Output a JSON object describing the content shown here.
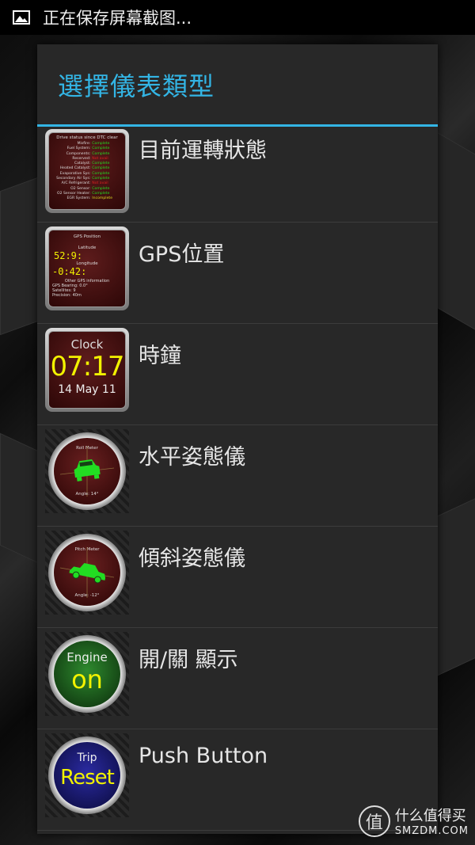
{
  "status_bar": {
    "notification_text": "正在保存屏幕截图..."
  },
  "dialog": {
    "title": "選擇儀表類型",
    "items": [
      {
        "label": "目前運轉狀態",
        "thumb": {
          "header": "Drive status since DTC clear",
          "rows": [
            {
              "name": "Misfire:",
              "value": "Complete",
              "color": "#22dd22"
            },
            {
              "name": "Fuel System:",
              "value": "Complete",
              "color": "#22dd22"
            },
            {
              "name": "Components:",
              "value": "Complete",
              "color": "#22dd22"
            },
            {
              "name": "Reserved:",
              "value": "Not avail",
              "color": "#dd2222"
            },
            {
              "name": "Catalyst:",
              "value": "Complete",
              "color": "#22dd22"
            },
            {
              "name": "Heated Catalyst:",
              "value": "Complete",
              "color": "#22dd22"
            },
            {
              "name": "Evaporative Sys:",
              "value": "Complete",
              "color": "#22dd22"
            },
            {
              "name": "Secondary Air Sys:",
              "value": "Complete",
              "color": "#22dd22"
            },
            {
              "name": "A/C Refrigerant:",
              "value": "Not avail",
              "color": "#dd2222"
            },
            {
              "name": "O2 Sensor:",
              "value": "Complete",
              "color": "#22dd22"
            },
            {
              "name": "O2 Sensor Heater:",
              "value": "Complete",
              "color": "#22dd22"
            },
            {
              "name": "EGR System:",
              "value": "Incomplete",
              "color": "#dddd22"
            }
          ]
        }
      },
      {
        "label": "GPS位置",
        "thumb": {
          "header": "GPS Position",
          "lat_label": "Latitude",
          "lat_value": "52:9:",
          "lon_label": "Longitude",
          "lon_value": "-0:42:",
          "other_label": "Other GPS information",
          "bearing": "GPS Bearing: 0.0°",
          "satellites": "Satellites: 9",
          "precision": "Precision: 40m"
        }
      },
      {
        "label": "時鐘",
        "thumb": {
          "header": "Clock",
          "time": "07:17",
          "date": "14 May 11"
        }
      },
      {
        "label": "水平姿態儀",
        "thumb": {
          "header": "Roll Meter",
          "angle": "Angle: 14°"
        }
      },
      {
        "label": "傾斜姿態儀",
        "thumb": {
          "header": "Pitch Meter",
          "angle": "Angle: -12°"
        }
      },
      {
        "label": "開/關 顯示",
        "thumb": {
          "header": "Engine",
          "state": "on"
        }
      },
      {
        "label": "Push Button",
        "thumb": {
          "header": "Trip",
          "action": "Reset"
        }
      }
    ]
  },
  "watermark": {
    "logo_char": "值",
    "line1": "什么值得买",
    "line2": "SMZDM.COM"
  },
  "colors": {
    "accent": "#33b5e5",
    "dialog_bg": "#282828",
    "gauge_yellow": "#f2f200",
    "gauge_green": "#22dd22"
  }
}
